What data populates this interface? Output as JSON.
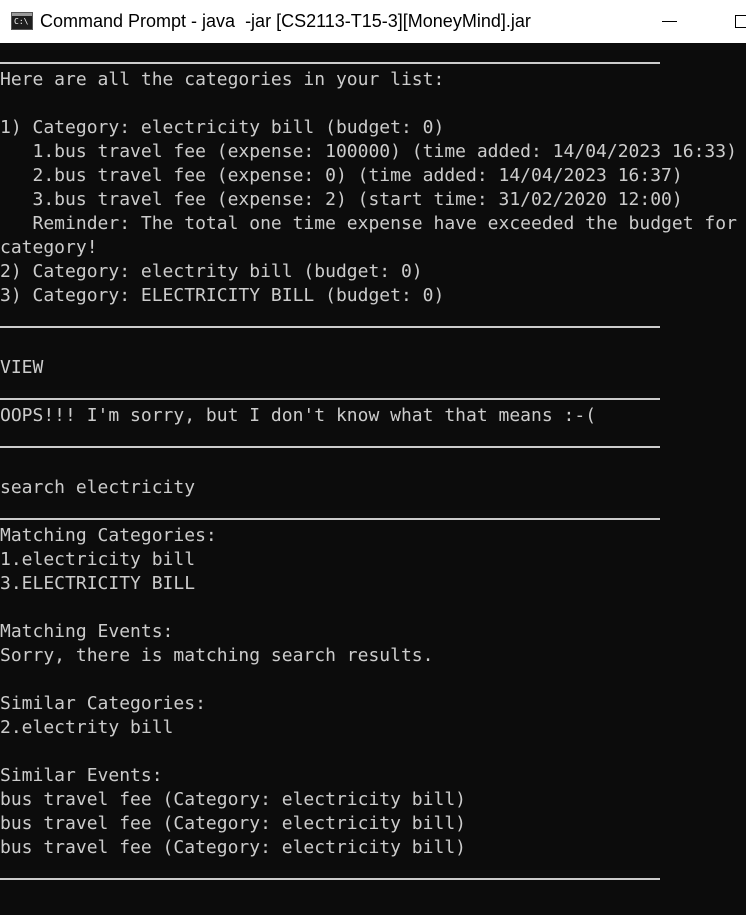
{
  "window": {
    "title": "Command Prompt - java  -jar [CS2113-T15-3][MoneyMind].jar",
    "icon_text": "C:\\",
    "icon": "command-prompt-icon",
    "minimize_icon": "minimize-icon",
    "maximize_icon": "maximize-icon"
  },
  "console": {
    "list_header": "Here are all the categories in your list:",
    "categories": [
      "1) Category: electricity bill (budget: 0)",
      "   1.bus travel fee (expense: 100000) (time added: 14/04/2023 16:33)",
      "   2.bus travel fee (expense: 0) (time added: 14/04/2023 16:37)",
      "   3.bus travel fee (expense: 2) (start time: 31/02/2020 12:00)",
      "   Reminder: The total one time expense have exceeded the budget for",
      "category!",
      "2) Category: electrity bill (budget: 0)",
      "3) Category: ELECTRICITY BILL (budget: 0)"
    ],
    "command_view": "VIEW",
    "error_message": "OOPS!!! I'm sorry, but I don't know what that means :-(",
    "command_search": "search electricity",
    "search_results": [
      "Matching Categories:",
      "1.electricity bill",
      "3.ELECTRICITY BILL",
      "",
      "Matching Events:",
      "Sorry, there is matching search results.",
      "",
      "Similar Categories:",
      "2.electrity bill",
      "",
      "Similar Events:",
      "bus travel fee (Category: electricity bill)",
      "bus travel fee (Category: electricity bill)",
      "bus travel fee (Category: electricity bill)"
    ]
  },
  "colors": {
    "background": "#0c0c0c",
    "text": "#cccccc",
    "titlebar": "#ffffff"
  }
}
